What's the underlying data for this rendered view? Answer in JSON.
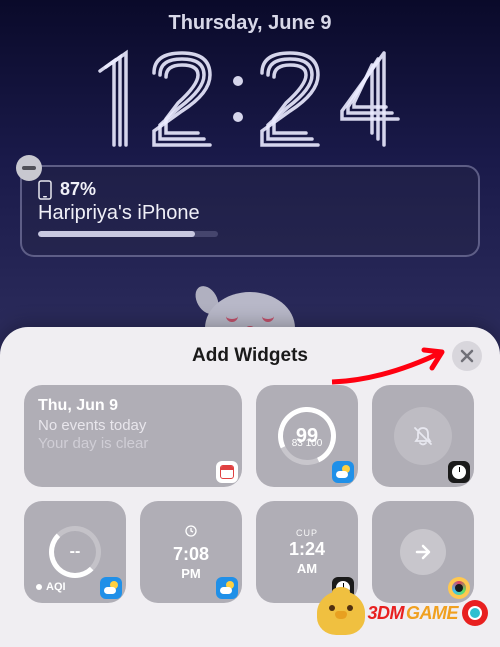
{
  "date": "Thursday, June 9",
  "time": "12:24",
  "battery": {
    "percent": "87%",
    "device_name": "Haripriya's iPhone",
    "fill_percent": 87
  },
  "sheet": {
    "title": "Add Widgets"
  },
  "widgets": {
    "calendar": {
      "line1": "Thu, Jun 9",
      "line2": "No events today",
      "line3": "Your day is clear"
    },
    "weather_aqi_big": {
      "value": "99",
      "sub": "83 100"
    },
    "aqi_small": {
      "value": "--",
      "label": "AQI"
    },
    "clock_local": {
      "city": "",
      "time": "7:08",
      "ampm": "PM"
    },
    "clock_cup": {
      "city": "CUP",
      "time": "1:24",
      "ampm": "AM"
    }
  },
  "logo": {
    "brand1": "3DM",
    "brand2": "GAME"
  }
}
